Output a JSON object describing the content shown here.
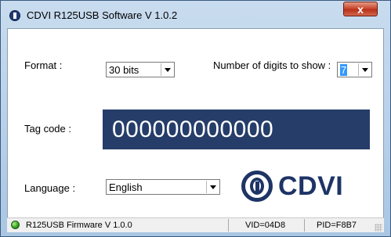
{
  "window": {
    "title": "CDVI R125USB Software V 1.0.2",
    "close_label": "x"
  },
  "form": {
    "format_label": "Format :",
    "format_value": "30 bits",
    "digits_label": "Number of digits to show :",
    "digits_value": "7",
    "tag_label": "Tag code :",
    "tag_value": "000000000000",
    "language_label": "Language :",
    "language_value": "English"
  },
  "logo": {
    "text": "CDVI"
  },
  "statusbar": {
    "firmware": "R125USB Firmware V 1.0.0",
    "vid": "VID=04D8",
    "pid": "PID=F8B7"
  },
  "colors": {
    "tag_background": "#263d6a",
    "logo_blue": "#1e3466",
    "status_led": "#2f9a17"
  }
}
